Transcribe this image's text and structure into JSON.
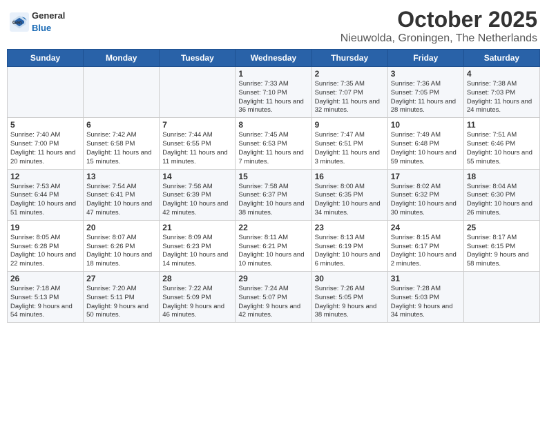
{
  "header": {
    "logo": {
      "general": "General",
      "blue": "Blue"
    },
    "title": "October 2025",
    "subtitle": "Nieuwolda, Groningen, The Netherlands"
  },
  "weekdays": [
    "Sunday",
    "Monday",
    "Tuesday",
    "Wednesday",
    "Thursday",
    "Friday",
    "Saturday"
  ],
  "weeks": [
    {
      "days": [
        {
          "num": "",
          "info": ""
        },
        {
          "num": "",
          "info": ""
        },
        {
          "num": "",
          "info": ""
        },
        {
          "num": "1",
          "info": "Sunrise: 7:33 AM\nSunset: 7:10 PM\nDaylight: 11 hours\nand 36 minutes."
        },
        {
          "num": "2",
          "info": "Sunrise: 7:35 AM\nSunset: 7:07 PM\nDaylight: 11 hours\nand 32 minutes."
        },
        {
          "num": "3",
          "info": "Sunrise: 7:36 AM\nSunset: 7:05 PM\nDaylight: 11 hours\nand 28 minutes."
        },
        {
          "num": "4",
          "info": "Sunrise: 7:38 AM\nSunset: 7:03 PM\nDaylight: 11 hours\nand 24 minutes."
        }
      ]
    },
    {
      "days": [
        {
          "num": "5",
          "info": "Sunrise: 7:40 AM\nSunset: 7:00 PM\nDaylight: 11 hours\nand 20 minutes."
        },
        {
          "num": "6",
          "info": "Sunrise: 7:42 AM\nSunset: 6:58 PM\nDaylight: 11 hours\nand 15 minutes."
        },
        {
          "num": "7",
          "info": "Sunrise: 7:44 AM\nSunset: 6:55 PM\nDaylight: 11 hours\nand 11 minutes."
        },
        {
          "num": "8",
          "info": "Sunrise: 7:45 AM\nSunset: 6:53 PM\nDaylight: 11 hours\nand 7 minutes."
        },
        {
          "num": "9",
          "info": "Sunrise: 7:47 AM\nSunset: 6:51 PM\nDaylight: 11 hours\nand 3 minutes."
        },
        {
          "num": "10",
          "info": "Sunrise: 7:49 AM\nSunset: 6:48 PM\nDaylight: 10 hours\nand 59 minutes."
        },
        {
          "num": "11",
          "info": "Sunrise: 7:51 AM\nSunset: 6:46 PM\nDaylight: 10 hours\nand 55 minutes."
        }
      ]
    },
    {
      "days": [
        {
          "num": "12",
          "info": "Sunrise: 7:53 AM\nSunset: 6:44 PM\nDaylight: 10 hours\nand 51 minutes."
        },
        {
          "num": "13",
          "info": "Sunrise: 7:54 AM\nSunset: 6:41 PM\nDaylight: 10 hours\nand 47 minutes."
        },
        {
          "num": "14",
          "info": "Sunrise: 7:56 AM\nSunset: 6:39 PM\nDaylight: 10 hours\nand 42 minutes."
        },
        {
          "num": "15",
          "info": "Sunrise: 7:58 AM\nSunset: 6:37 PM\nDaylight: 10 hours\nand 38 minutes."
        },
        {
          "num": "16",
          "info": "Sunrise: 8:00 AM\nSunset: 6:35 PM\nDaylight: 10 hours\nand 34 minutes."
        },
        {
          "num": "17",
          "info": "Sunrise: 8:02 AM\nSunset: 6:32 PM\nDaylight: 10 hours\nand 30 minutes."
        },
        {
          "num": "18",
          "info": "Sunrise: 8:04 AM\nSunset: 6:30 PM\nDaylight: 10 hours\nand 26 minutes."
        }
      ]
    },
    {
      "days": [
        {
          "num": "19",
          "info": "Sunrise: 8:05 AM\nSunset: 6:28 PM\nDaylight: 10 hours\nand 22 minutes."
        },
        {
          "num": "20",
          "info": "Sunrise: 8:07 AM\nSunset: 6:26 PM\nDaylight: 10 hours\nand 18 minutes."
        },
        {
          "num": "21",
          "info": "Sunrise: 8:09 AM\nSunset: 6:23 PM\nDaylight: 10 hours\nand 14 minutes."
        },
        {
          "num": "22",
          "info": "Sunrise: 8:11 AM\nSunset: 6:21 PM\nDaylight: 10 hours\nand 10 minutes."
        },
        {
          "num": "23",
          "info": "Sunrise: 8:13 AM\nSunset: 6:19 PM\nDaylight: 10 hours\nand 6 minutes."
        },
        {
          "num": "24",
          "info": "Sunrise: 8:15 AM\nSunset: 6:17 PM\nDaylight: 10 hours\nand 2 minutes."
        },
        {
          "num": "25",
          "info": "Sunrise: 8:17 AM\nSunset: 6:15 PM\nDaylight: 9 hours\nand 58 minutes."
        }
      ]
    },
    {
      "days": [
        {
          "num": "26",
          "info": "Sunrise: 7:18 AM\nSunset: 5:13 PM\nDaylight: 9 hours\nand 54 minutes."
        },
        {
          "num": "27",
          "info": "Sunrise: 7:20 AM\nSunset: 5:11 PM\nDaylight: 9 hours\nand 50 minutes."
        },
        {
          "num": "28",
          "info": "Sunrise: 7:22 AM\nSunset: 5:09 PM\nDaylight: 9 hours\nand 46 minutes."
        },
        {
          "num": "29",
          "info": "Sunrise: 7:24 AM\nSunset: 5:07 PM\nDaylight: 9 hours\nand 42 minutes."
        },
        {
          "num": "30",
          "info": "Sunrise: 7:26 AM\nSunset: 5:05 PM\nDaylight: 9 hours\nand 38 minutes."
        },
        {
          "num": "31",
          "info": "Sunrise: 7:28 AM\nSunset: 5:03 PM\nDaylight: 9 hours\nand 34 minutes."
        },
        {
          "num": "",
          "info": ""
        }
      ]
    }
  ]
}
